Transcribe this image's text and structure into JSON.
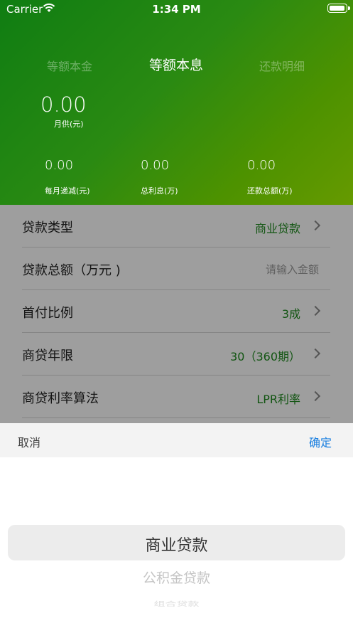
{
  "status_bar": {
    "carrier": "Carrier",
    "time": "1:34 PM"
  },
  "tabs": [
    {
      "label": "等额本金"
    },
    {
      "label": "等额本息"
    },
    {
      "label": "还款明细"
    }
  ],
  "summary": {
    "monthly_value": "0.00",
    "monthly_label": "月供(元)",
    "stats": [
      {
        "value": "0.00",
        "label": "每月递减(元)"
      },
      {
        "value": "0.00",
        "label": "总利息(万)"
      },
      {
        "value": "0.00",
        "label": "还款总额(万)"
      }
    ]
  },
  "form": {
    "rows": [
      {
        "label": "贷款类型",
        "value": "商业贷款"
      },
      {
        "label": "贷款总额（万元 )",
        "placeholder": "请输入金额"
      },
      {
        "label": "首付比例",
        "value": "3成"
      },
      {
        "label": "商贷年限",
        "value": "30（360期）"
      },
      {
        "label": "商贷利率算法",
        "value": "LPR利率"
      }
    ]
  },
  "picker": {
    "cancel": "取消",
    "confirm": "确定",
    "options": [
      "商业贷款",
      "公积金贷款",
      "组合贷款"
    ]
  },
  "colors": {
    "accent_green": "#1e8a1e",
    "link_blue": "#1a7fe0",
    "header_start": "#0f7d12",
    "header_end": "#669a00"
  }
}
